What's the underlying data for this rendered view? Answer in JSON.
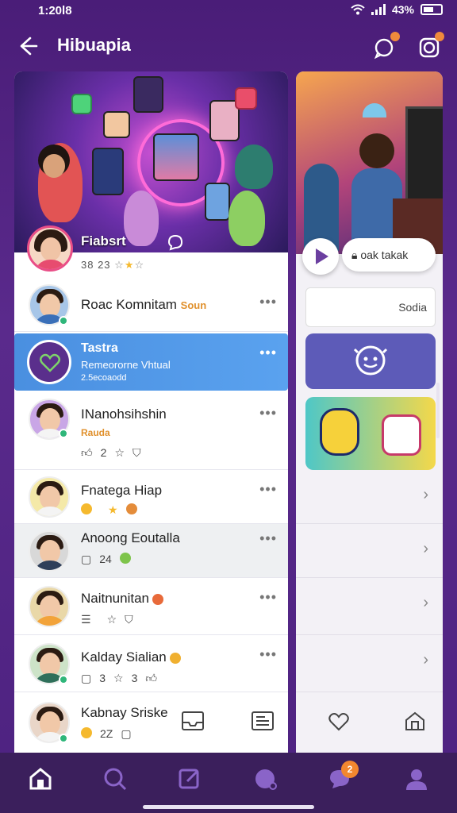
{
  "status_bar": {
    "time": "1:20l8",
    "battery": "43%"
  },
  "app_bar": {
    "title": "Hibuapia"
  },
  "featured": {
    "title": "Fiabsrt",
    "meta": "38 23"
  },
  "list": [
    {
      "name": "Roac Komnitam",
      "tag": "Soun"
    },
    {
      "name": "Tastra",
      "sub": "Remeororne Vhtual",
      "meta": "2.5ecoaodd"
    },
    {
      "name": "INanohsihshin",
      "tag": "Rauda",
      "actions": [
        "2",
        ""
      ]
    },
    {
      "name": "Fnatega Hiap",
      "actions": [
        ""
      ]
    },
    {
      "name": "Anoong Eoutalla",
      "actions": [
        "24"
      ]
    },
    {
      "name": "Naitnunitan",
      "actions": [
        ""
      ]
    },
    {
      "name": "Kalday Sialian",
      "actions": [
        "3",
        "3"
      ]
    },
    {
      "name": "Kabnay Sriske",
      "actions": [
        "2Z"
      ]
    }
  ],
  "right": {
    "pill": "oak takak",
    "search_value": "Sodia"
  },
  "bottom_nav": {
    "messages_badge": "2"
  },
  "colors": {
    "accent": "#5a2a8c",
    "selected": "#4a8fe0",
    "badge": "#f2872f"
  }
}
